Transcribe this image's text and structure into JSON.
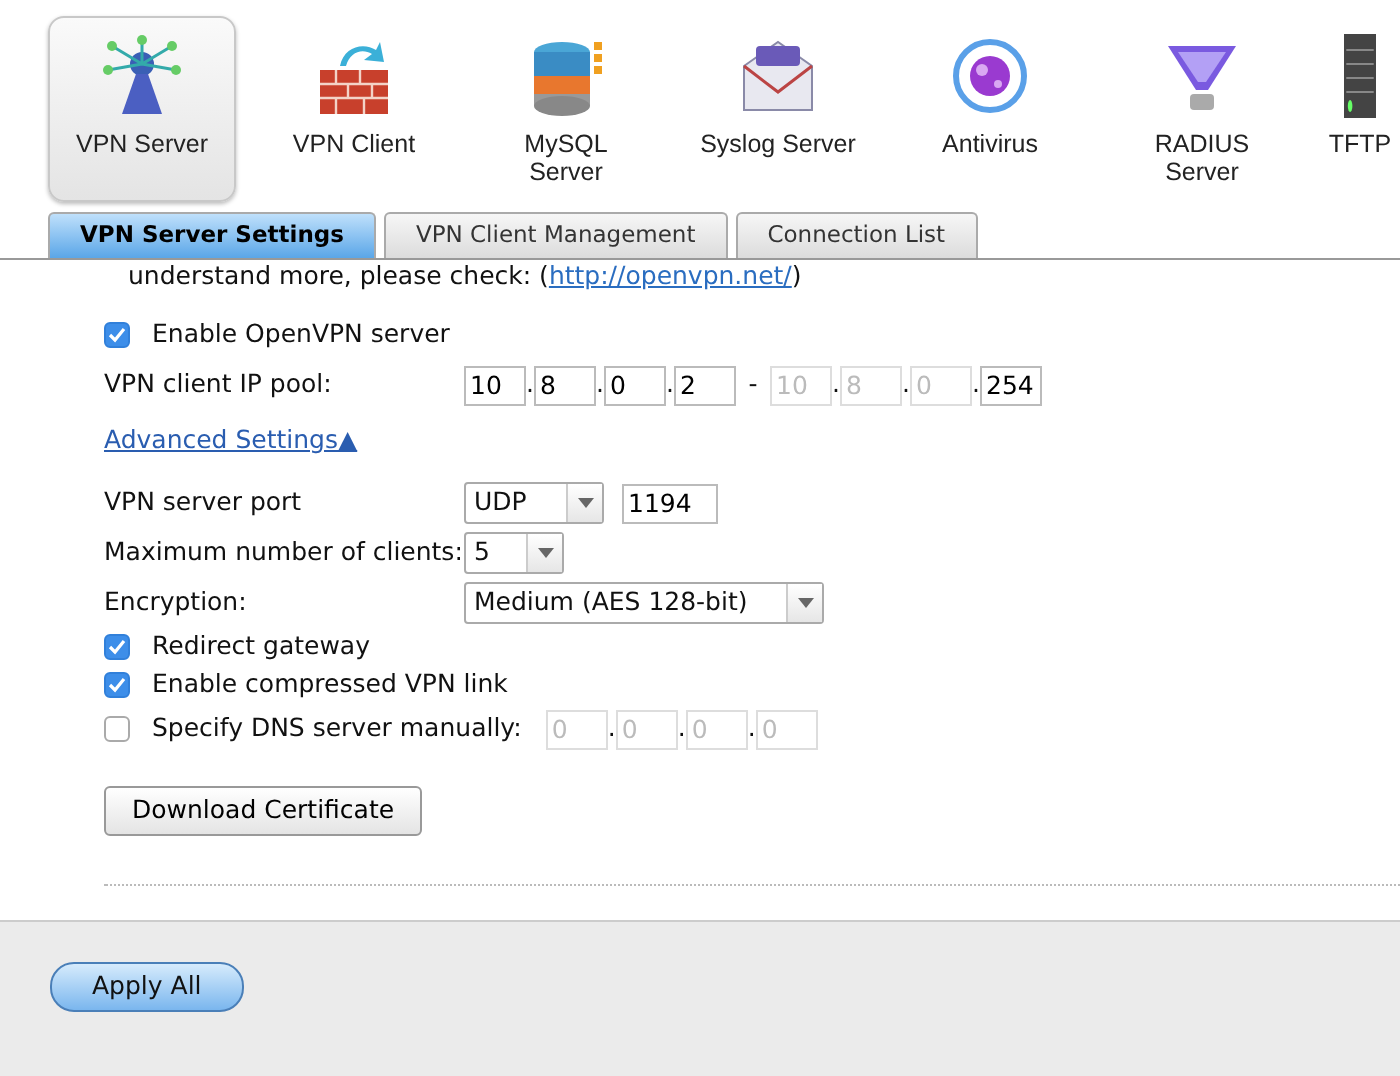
{
  "apps": [
    {
      "label": "VPN Server",
      "selected": true
    },
    {
      "label": "VPN Client",
      "selected": false
    },
    {
      "label": "MySQL Server",
      "selected": false
    },
    {
      "label": "Syslog Server",
      "selected": false
    },
    {
      "label": "Antivirus",
      "selected": false
    },
    {
      "label": "RADIUS Server",
      "selected": false
    },
    {
      "label": "TFTP",
      "selected": false
    }
  ],
  "tabs": [
    {
      "label": "VPN Server Settings",
      "selected": true
    },
    {
      "label": "VPN Client Management",
      "selected": false
    },
    {
      "label": "Connection List",
      "selected": false
    }
  ],
  "intro": "understand more, please check: (http://openvpn.net/)",
  "enable_openvpn": {
    "label": "Enable OpenVPN server",
    "checked": true
  },
  "ip_pool": {
    "label": "VPN client IP pool:",
    "dash": "-",
    "octets": [
      {
        "value": "10",
        "disabled": false
      },
      {
        "dot": ".",
        "value": "8",
        "disabled": false
      },
      {
        "dot": ".",
        "value": "0",
        "disabled": false
      },
      {
        "dot": ".",
        "value": "2",
        "disabled": false
      },
      {
        "value": "10",
        "disabled": true
      },
      {
        "dot": ".",
        "value": "8",
        "disabled": true
      },
      {
        "dot": ".",
        "value": "0",
        "disabled": true
      },
      {
        "dot": ".",
        "value": "254",
        "disabled": false
      }
    ]
  },
  "advanced_link": "Advanced Settings▲",
  "port": {
    "label": "VPN server port",
    "protocol": "UDP",
    "value": "1194"
  },
  "max_clients": {
    "label": "Maximum number of clients:",
    "value": "5"
  },
  "encryption": {
    "label": "Encryption:",
    "value": "Medium (AES 128-bit)"
  },
  "options": [
    {
      "label": "Redirect gateway",
      "checked": true
    },
    {
      "label": "Enable compressed VPN link",
      "checked": true
    }
  ],
  "dns": {
    "label": "Specify DNS server manually:",
    "checked": false,
    "octets": [
      {
        "value": "0",
        "disabled": true
      },
      {
        "dot": ".",
        "value": "0",
        "disabled": true
      },
      {
        "dot": ".",
        "value": "0",
        "disabled": true
      },
      {
        "dot": ".",
        "value": "0",
        "disabled": true
      }
    ]
  },
  "download_button": "Download Certificate",
  "apply_button": "Apply All"
}
